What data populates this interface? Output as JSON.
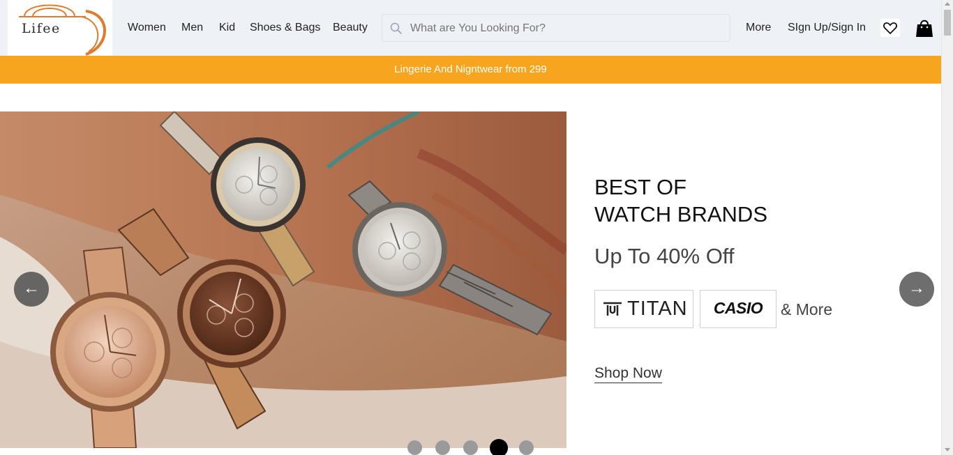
{
  "brand": {
    "logo_text": "Lifee"
  },
  "nav": {
    "items": [
      {
        "label": "Women"
      },
      {
        "label": "Men"
      },
      {
        "label": "Kid"
      },
      {
        "label": "Shoes & Bags"
      },
      {
        "label": "Beauty"
      }
    ],
    "more": "More",
    "signin": "SIgn Up/Sign In"
  },
  "search": {
    "placeholder": "What are You Looking For?",
    "value": ""
  },
  "icons": {
    "search": "search-icon",
    "wishlist": "heart-icon",
    "cart": "shopping-bag-icon",
    "prev": "arrow-left-icon",
    "next": "arrow-right-icon"
  },
  "promo": {
    "text": "Lingerie And Nigntwear from 299"
  },
  "hero": {
    "headline_line1": "BEST OF",
    "headline_line2": "WATCH BRANDS",
    "offer": "Up To 40% Off",
    "brands": [
      {
        "label": "TITAN"
      },
      {
        "label": "CASIO"
      }
    ],
    "and_more": "& More",
    "cta": "Shop Now",
    "prev": "←",
    "next": "→",
    "slides_total": 5,
    "active_slide": 4
  },
  "colors": {
    "header_bg": "#eef1f6",
    "promo_bg": "#f7a51e",
    "logo_orange": "#e07a2c",
    "active_dot": "#000000",
    "inactive_dot": "#9a9a9a"
  }
}
